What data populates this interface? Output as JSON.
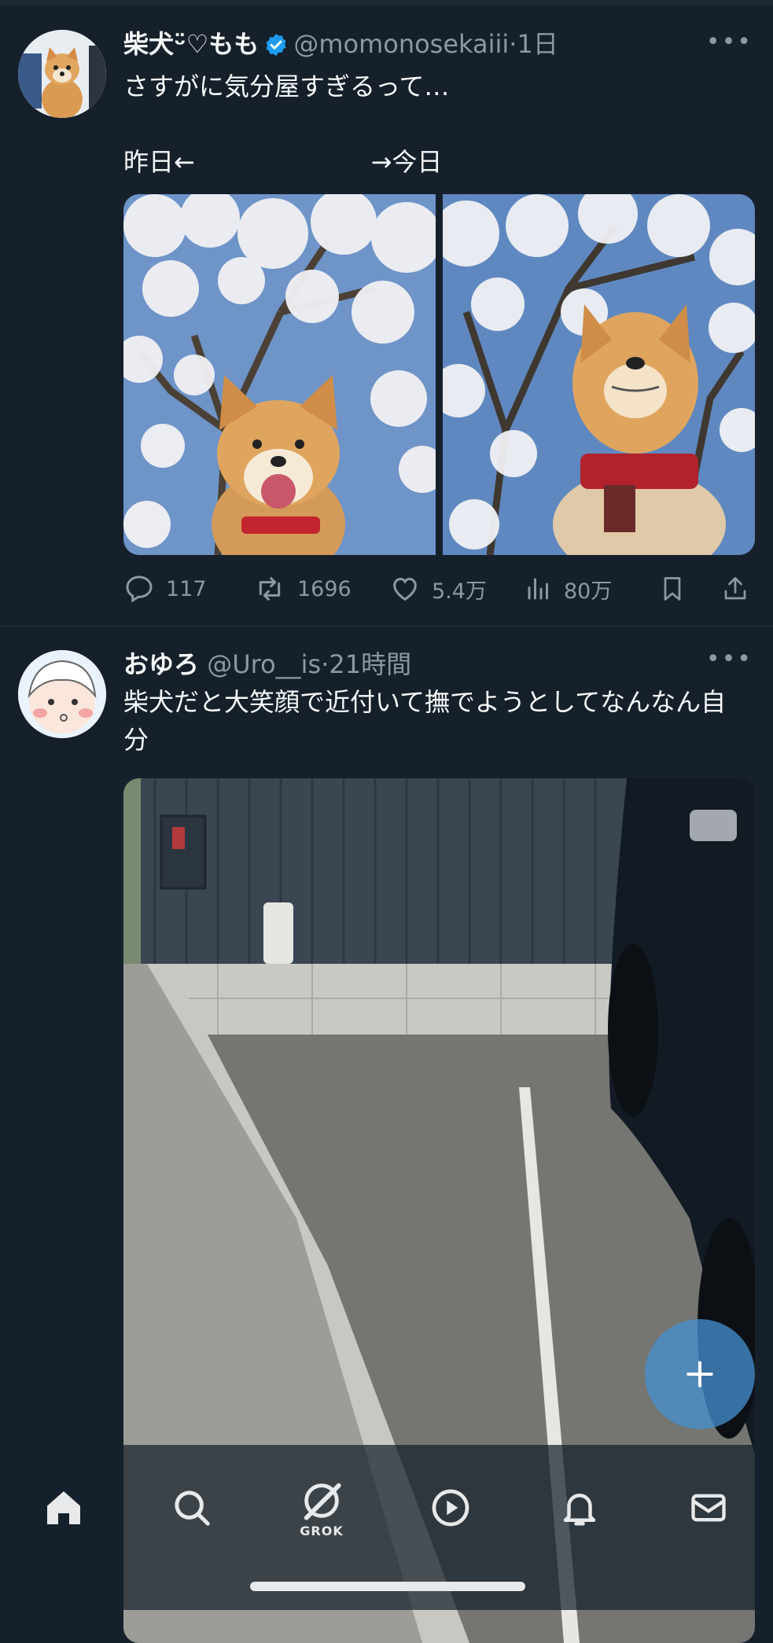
{
  "feed": {
    "tweets": [
      {
        "display_name": "柴犬ᵕ̈♡もも",
        "handle": "@momonosekaiii",
        "time": "1日",
        "text": "さすがに気分屋すぎるって…\n\n昨日←                      →今日",
        "photos": [
          "shiba-smiling-cherry-blossoms",
          "shiba-serious-cherry-blossoms"
        ],
        "replies": "117",
        "reposts": "1696",
        "likes": "5.4万",
        "views": "80万"
      },
      {
        "display_name": "おゆろ",
        "handle": "@Uro__is",
        "time": "21時間",
        "text": "柴犬だと大笑顔で近付いて撫でようとしてなんなん自分",
        "photos": [
          "parking-space-wall-car"
        ]
      }
    ]
  },
  "separator": "·",
  "more_glyph": "•••",
  "fab": {
    "icon": "plus-icon"
  },
  "tabbar": {
    "items": [
      {
        "icon": "home-icon",
        "label": ""
      },
      {
        "icon": "search-icon",
        "label": ""
      },
      {
        "icon": "grok-icon",
        "label": "GROK"
      },
      {
        "icon": "play-icon",
        "label": ""
      },
      {
        "icon": "bell-icon",
        "label": ""
      },
      {
        "icon": "mail-icon",
        "label": ""
      }
    ]
  },
  "colors": {
    "background": "#15202b",
    "text": "#f7f9f9",
    "secondary": "#8b98a5",
    "verified": "#1d9bf0",
    "fab": "#4691d2"
  }
}
